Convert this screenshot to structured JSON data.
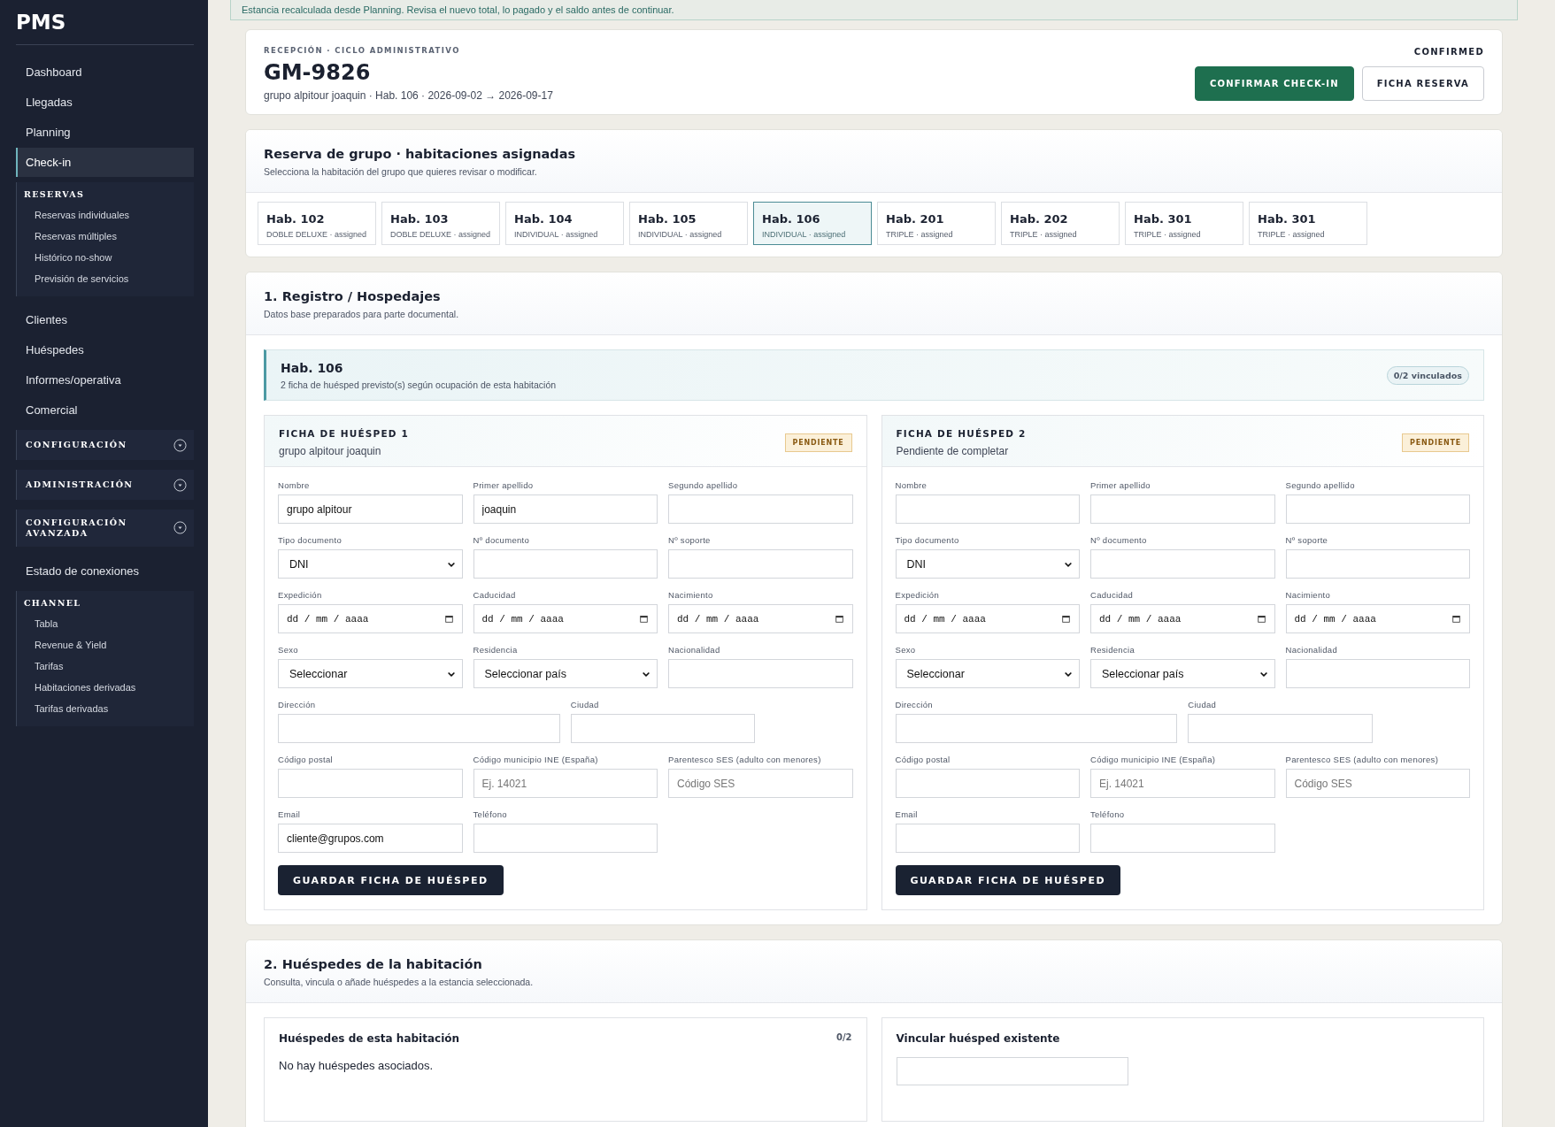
{
  "sidebar": {
    "brand": "PMS",
    "items": [
      {
        "kind": "link",
        "label": "Dashboard",
        "selected": false
      },
      {
        "kind": "link",
        "label": "Llegadas",
        "selected": false
      },
      {
        "kind": "link",
        "label": "Planning",
        "selected": false
      },
      {
        "kind": "link",
        "label": "Check-in",
        "selected": true
      },
      {
        "kind": "group",
        "label": "RESERVAS",
        "children": [
          {
            "label": "Reservas individuales"
          },
          {
            "label": "Reservas múltiples"
          },
          {
            "label": "Histórico no-show"
          },
          {
            "label": "Previsión de servicios"
          }
        ]
      },
      {
        "kind": "link",
        "label": "Clientes",
        "selected": false
      },
      {
        "kind": "link",
        "label": "Huéspedes",
        "selected": false
      },
      {
        "kind": "link",
        "label": "Informes/operativa",
        "selected": false
      },
      {
        "kind": "link",
        "label": "Comercial",
        "selected": false
      },
      {
        "kind": "section",
        "label": "CONFIGURACIÓN",
        "expanded": false
      },
      {
        "kind": "section",
        "label": "ADMINISTRACIÓN",
        "expanded": false
      },
      {
        "kind": "section",
        "label": "CONFIGURACIÓN AVANZADA",
        "expanded": false
      },
      {
        "kind": "link",
        "label": "Estado de conexiones",
        "selected": false
      },
      {
        "kind": "group",
        "label": "CHANNEL",
        "children": [
          {
            "label": "Tabla"
          },
          {
            "label": "Revenue & Yield"
          },
          {
            "label": "Tarifas"
          },
          {
            "label": "Habitaciones derivadas"
          },
          {
            "label": "Tarifas derivadas"
          }
        ]
      }
    ]
  },
  "notice": "Estancia recalculada desde Planning. Revisa el nuevo total, lo pagado y el saldo antes de continuar.",
  "header": {
    "eyebrow": "RECEPCIÓN · CICLO ADMINISTRATIVO",
    "title": "GM-9826",
    "subtitle": "grupo alpitour joaquin · Hab. 106 · 2026-09-02 → 2026-09-17",
    "status": "CONFIRMED",
    "buttons": [
      {
        "kind": "primary",
        "label": "CONFIRMAR CHECK-IN"
      },
      {
        "kind": "secondary",
        "label": "FICHA RESERVA"
      }
    ]
  },
  "group": {
    "title": "Reserva de grupo · habitaciones asignadas",
    "subtitle": "Selecciona la habitación del grupo que quieres revisar o modificar.",
    "rooms": [
      {
        "name": "Hab. 102",
        "detail": "DOBLE DELUXE · assigned",
        "selected": false
      },
      {
        "name": "Hab. 103",
        "detail": "DOBLE DELUXE · assigned",
        "selected": false
      },
      {
        "name": "Hab. 104",
        "detail": "INDIVIDUAL · assigned",
        "selected": false
      },
      {
        "name": "Hab. 105",
        "detail": "INDIVIDUAL · assigned",
        "selected": false
      },
      {
        "name": "Hab. 106",
        "detail": "INDIVIDUAL · assigned",
        "selected": true
      },
      {
        "name": "Hab. 201",
        "detail": "TRIPLE · assigned",
        "selected": false
      },
      {
        "name": "Hab. 202",
        "detail": "TRIPLE · assigned",
        "selected": false
      },
      {
        "name": "Hab. 301",
        "detail": "TRIPLE · assigned",
        "selected": false
      },
      {
        "name": "Hab. 301",
        "detail": "TRIPLE · assigned",
        "selected": false
      }
    ]
  },
  "registro": {
    "title": "1. Registro / Hospedajes",
    "subtitle": "Datos base preparados para parte documental.",
    "room": {
      "title": "Hab. 106",
      "subtitle": "2 ficha de huésped previsto(s) según ocupación de esta habitación",
      "badge": "0/2 vinculados"
    },
    "guests": [
      {
        "title": "FICHA DE HUÉSPED 1",
        "subtitle": "grupo alpitour joaquin",
        "status": "PENDIENTE",
        "save": "GUARDAR FICHA DE HUÉSPED",
        "fields": [
          {
            "kind": "text",
            "label": "Nombre",
            "value": "grupo alpitour"
          },
          {
            "kind": "text",
            "label": "Primer apellido",
            "value": "joaquin"
          },
          {
            "kind": "text",
            "label": "Segundo apellido"
          },
          {
            "kind": "select",
            "label": "Tipo documento",
            "value": "DNI"
          },
          {
            "kind": "text",
            "label": "Nº documento"
          },
          {
            "kind": "text",
            "label": "Nº soporte"
          },
          {
            "kind": "date",
            "label": "Expedición",
            "placeholder": "dd / mm / aaaa"
          },
          {
            "kind": "date",
            "label": "Caducidad",
            "placeholder": "dd / mm / aaaa"
          },
          {
            "kind": "date",
            "label": "Nacimiento",
            "placeholder": "dd / mm / aaaa"
          },
          {
            "kind": "select",
            "label": "Sexo",
            "value": "Seleccionar"
          },
          {
            "kind": "select",
            "label": "Residencia",
            "value": "Seleccionar país"
          },
          {
            "kind": "text",
            "label": "Nacionalidad"
          },
          {
            "kind": "wide",
            "label": "Dirección"
          },
          {
            "kind": "text",
            "label": "Ciudad"
          },
          {
            "kind": "break"
          },
          {
            "kind": "text",
            "label": "Código postal"
          },
          {
            "kind": "text",
            "label": "Código municipio INE (España)",
            "placeholder": "Ej. 14021"
          },
          {
            "kind": "text",
            "label": "Parentesco SES (adulto con menores)",
            "placeholder": "Código SES"
          },
          {
            "kind": "text",
            "label": "Email",
            "value": "cliente@grupos.com"
          },
          {
            "kind": "text",
            "label": "Teléfono"
          }
        ]
      },
      {
        "title": "FICHA DE HUÉSPED 2",
        "subtitle": "Pendiente de completar",
        "status": "PENDIENTE",
        "save": "GUARDAR FICHA DE HUÉSPED",
        "fields": [
          {
            "kind": "text",
            "label": "Nombre"
          },
          {
            "kind": "text",
            "label": "Primer apellido"
          },
          {
            "kind": "text",
            "label": "Segundo apellido"
          },
          {
            "kind": "select",
            "label": "Tipo documento",
            "value": "DNI"
          },
          {
            "kind": "text",
            "label": "Nº documento"
          },
          {
            "kind": "text",
            "label": "Nº soporte"
          },
          {
            "kind": "date",
            "label": "Expedición",
            "placeholder": "dd / mm / aaaa"
          },
          {
            "kind": "date",
            "label": "Caducidad",
            "placeholder": "dd / mm / aaaa"
          },
          {
            "kind": "date",
            "label": "Nacimiento",
            "placeholder": "dd / mm / aaaa"
          },
          {
            "kind": "select",
            "label": "Sexo",
            "value": "Seleccionar"
          },
          {
            "kind": "select",
            "label": "Residencia",
            "value": "Seleccionar país"
          },
          {
            "kind": "text",
            "label": "Nacionalidad"
          },
          {
            "kind": "wide",
            "label": "Dirección"
          },
          {
            "kind": "text",
            "label": "Ciudad"
          },
          {
            "kind": "break"
          },
          {
            "kind": "text",
            "label": "Código postal"
          },
          {
            "kind": "text",
            "label": "Código municipio INE (España)",
            "placeholder": "Ej. 14021"
          },
          {
            "kind": "text",
            "label": "Parentesco SES (adulto con menores)",
            "placeholder": "Código SES"
          },
          {
            "kind": "text",
            "label": "Email"
          },
          {
            "kind": "text",
            "label": "Teléfono"
          }
        ]
      }
    ]
  },
  "huespedes": {
    "title": "2. Huéspedes de la habitación",
    "subtitle": "Consulta, vincula o añade huéspedes a la estancia seleccionada.",
    "list": {
      "title": "Huéspedes de esta habitación",
      "count": "0/2",
      "empty": "No hay huéspedes asociados."
    },
    "link": {
      "title": "Vincular huésped existente"
    }
  }
}
